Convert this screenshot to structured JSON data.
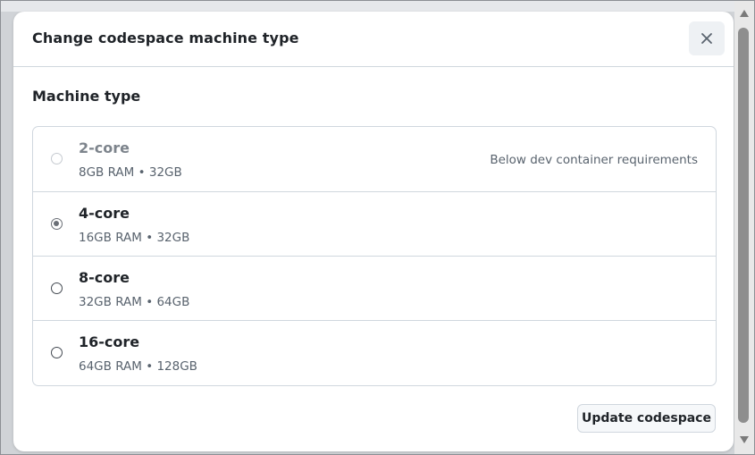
{
  "dialog": {
    "title": "Change codespace machine type",
    "section_title": "Machine type",
    "options": [
      {
        "name": "2-core",
        "spec": "8GB RAM • 32GB",
        "note": "Below dev container requirements",
        "state": "disabled"
      },
      {
        "name": "4-core",
        "spec": "16GB RAM • 32GB",
        "note": "",
        "state": "selected"
      },
      {
        "name": "8-core",
        "spec": "32GB RAM • 64GB",
        "note": "",
        "state": "unselected"
      },
      {
        "name": "16-core",
        "spec": "64GB RAM • 128GB",
        "note": "",
        "state": "unselected"
      }
    ],
    "update_button": "Update codespace"
  },
  "icons": {
    "close": "close-icon",
    "scroll_up": "triangle-up-icon",
    "scroll_down": "triangle-down-icon"
  },
  "colors": {
    "text_primary": "#1f2328",
    "text_muted": "#59636e",
    "border": "#d0d7de",
    "button_bg": "#f6f8fa"
  }
}
